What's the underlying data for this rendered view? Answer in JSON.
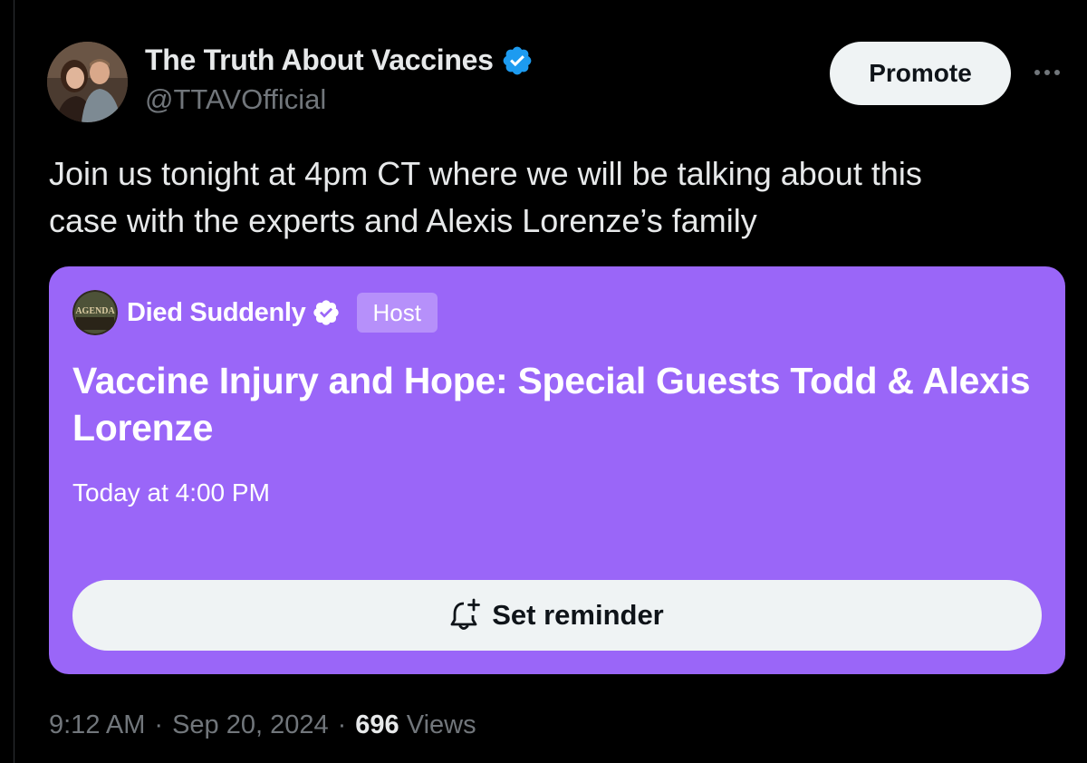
{
  "author": {
    "display_name": "The Truth About Vaccines",
    "handle": "@TTAVOfficial",
    "verified_icon": "verified-badge-icon",
    "verified_color": "#1d9bf0"
  },
  "actions": {
    "promote_label": "Promote",
    "more_icon": "more-horizontal-icon"
  },
  "tweet": {
    "text": "Join us tonight at 4pm CT where we will be talking about this\ncase with the experts and Alexis Lorenze’s family"
  },
  "space": {
    "background_color": "#9a66f8",
    "host_name": "Died Suddenly",
    "host_badge": "Host",
    "avatar_text": "AGENDA",
    "title": "Vaccine Injury and Hope: Special Guests Todd & Alexis Lorenze",
    "time": "Today at 4:00 PM",
    "reminder_label": "Set reminder",
    "reminder_icon": "bell-plus-icon"
  },
  "meta": {
    "time": "9:12 AM",
    "separator": "·",
    "date": "Sep 20, 2024",
    "views_count": "696",
    "views_label": "Views"
  }
}
